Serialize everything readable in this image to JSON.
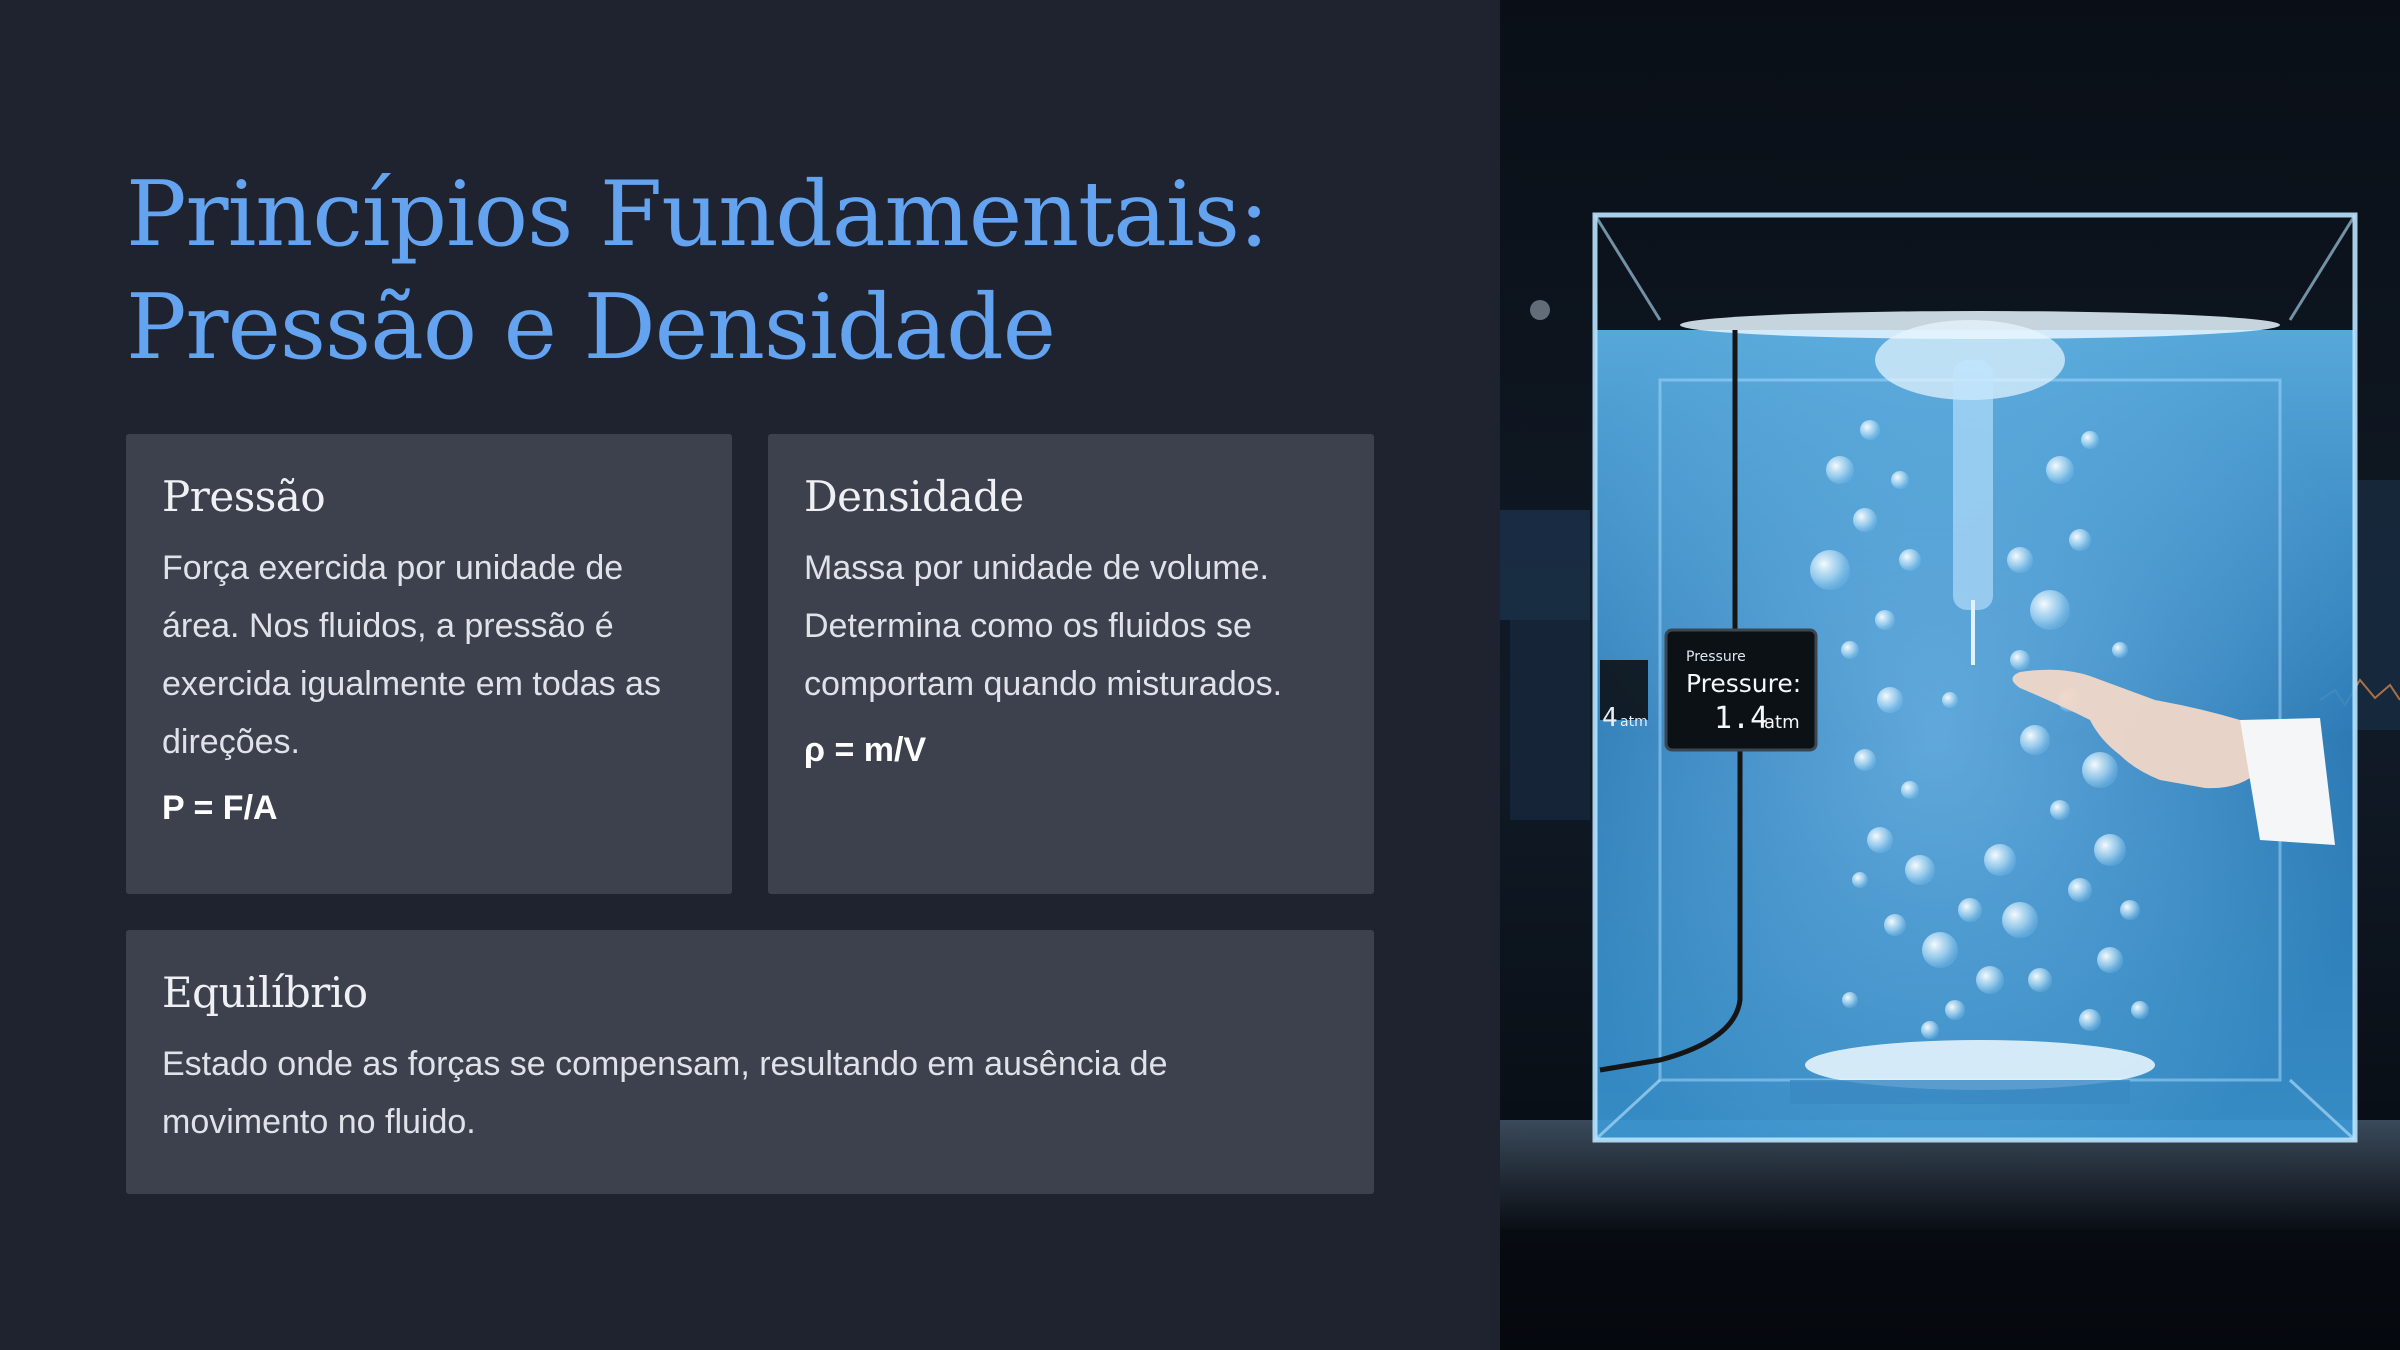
{
  "slide": {
    "title": "Princípios Fundamentais: Pressão e Densidade"
  },
  "cards": {
    "pressao": {
      "heading": "Pressão",
      "text": "Força exercida por unidade de área. Nos fluidos, a pressão é exercida igualmente em todas as direções.",
      "formula": "P = F/A"
    },
    "densidade": {
      "heading": "Densidade",
      "text": "Massa por unidade de volume. Determina como os fluidos se comportam quando misturados.",
      "formula": "ρ = m/V"
    },
    "equilibrio": {
      "heading": "Equilíbrio",
      "text": "Estado onde as forças se compensam, resultando em ausência de movimento no fluido."
    }
  },
  "image": {
    "display_small_label": "Pressure",
    "display_label": "Pressure:",
    "display_value": "1.4",
    "display_unit": "atm",
    "side_value": "4",
    "side_unit": "atm"
  },
  "colors": {
    "background": "#1f2330",
    "title": "#63a3ef",
    "card": "#3d414d"
  }
}
